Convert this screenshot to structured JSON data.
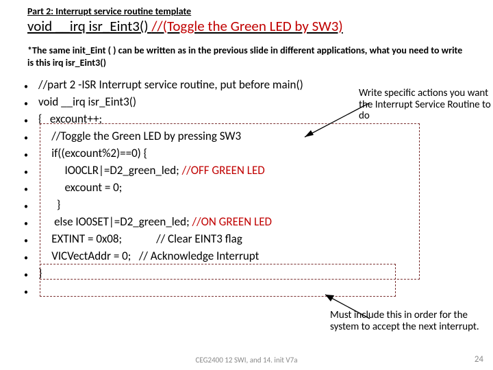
{
  "part_label": "Part 2: Interrupt service routine template",
  "title_pre": "void __irq isr_Eint3() ",
  "title_comment": "//(Toggle the Green LED by SW3)",
  "subtitle": "*The same init_Eint ( ) can be written as in the previous slide in different applications, what you need to write is this irq isr_Eint3()",
  "code": {
    "l1": "//part 2 -ISR Interrupt service routine, put before main()",
    "l2": "void __irq isr_Eint3()",
    "l3a": "{",
    "l3b": "excount++;",
    "l4": "//Toggle the Green LED by pressing SW3",
    "l5": "if((excount%2)==0) {",
    "l6a": "IO0CLR|=D2_green_led; ",
    "l6b": "//OFF GREEN LED",
    "l7": "excount = 0;",
    "l8": "}",
    "l9a": "else IO0SET|=D2_green_led; ",
    "l9b": "//ON GREEN LED",
    "l10a": "EXTINT = 0x08;",
    "l10b": "// Clear EINT3 flag",
    "l11a": "VICVectAddr = 0;",
    "l11b": "// Acknowledge Interrupt",
    "l12": "}"
  },
  "note1": "Write specific actions you want the Interrupt Service Routine to do",
  "note2": "Must include this in order for the system to accept the next interrupt.",
  "footer": "CEG2400 12 SWI, and 14. init V7a",
  "slidenum": "24"
}
